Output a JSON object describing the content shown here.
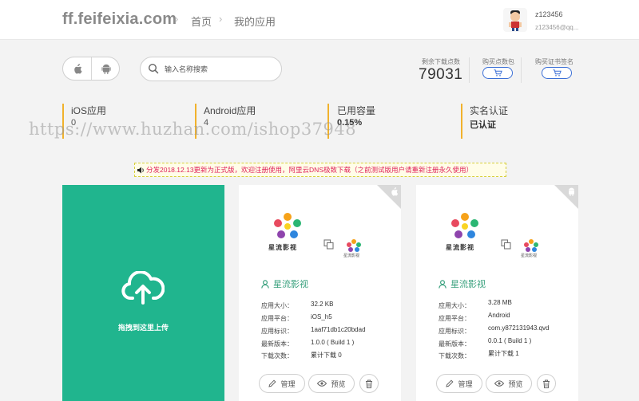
{
  "header": {
    "logo": "ff.feifeixia.com",
    "breadcrumb": [
      "首页",
      "我的应用"
    ],
    "user": {
      "name": "z123456",
      "email": "z123456@qq..."
    }
  },
  "toolbar": {
    "search_placeholder": "输入名称搜索",
    "remaining_label": "剩余下载点数",
    "remaining_value": "79031",
    "buy_points_label": "购买点数包",
    "buy_cert_label": "购买证书签名"
  },
  "stats": [
    {
      "label": "iOS应用",
      "value": "0"
    },
    {
      "label": "Android应用",
      "value": "4"
    },
    {
      "label": "已用容量",
      "value": "0.15%"
    },
    {
      "label": "实名认证",
      "value": "已认证"
    }
  ],
  "watermark": "https://www.huzhan.com/ishop37948",
  "notice": "分发2018.12.13更新为正式版，欢迎注册使用，阿里云DNS极致下载（之前测试版用户请重新注册永久使用）",
  "upload": {
    "label": "拖拽到这里上传"
  },
  "apps": [
    {
      "logo_text": "星流影视",
      "qr_caption": "星流影视",
      "name": "星流影视",
      "fields": [
        {
          "k": "应用大小：",
          "v": "32.2 KB"
        },
        {
          "k": "应用平台：",
          "v": "iOS_h5"
        },
        {
          "k": "应用标识：",
          "v": "1aaf71db1c20bdad"
        },
        {
          "k": "最新版本：",
          "v": "1.0.0 ( Build 1 )"
        },
        {
          "k": "下载次数：",
          "v": "累计下载 0"
        }
      ],
      "manage_label": "管理",
      "preview_label": "预览",
      "platform_icon": "apple-icon"
    },
    {
      "logo_text": "星流影视",
      "qr_caption": "星流影视",
      "name": "星流影视",
      "fields": [
        {
          "k": "应用大小：",
          "v": "3.28 MB"
        },
        {
          "k": "应用平台：",
          "v": "Android"
        },
        {
          "k": "应用标识：",
          "v": "com.y872131943.qvd"
        },
        {
          "k": "最新版本：",
          "v": "0.0.1 ( Build 1 )"
        },
        {
          "k": "下载次数：",
          "v": "累计下载 1"
        }
      ],
      "manage_label": "管理",
      "preview_label": "预览",
      "platform_icon": "android-icon"
    }
  ],
  "colors": {
    "accent_green": "#20b58e",
    "stat_bar": "#f1b22c",
    "notice_text": "#e0205a",
    "cart_blue": "#3b6fd6"
  }
}
